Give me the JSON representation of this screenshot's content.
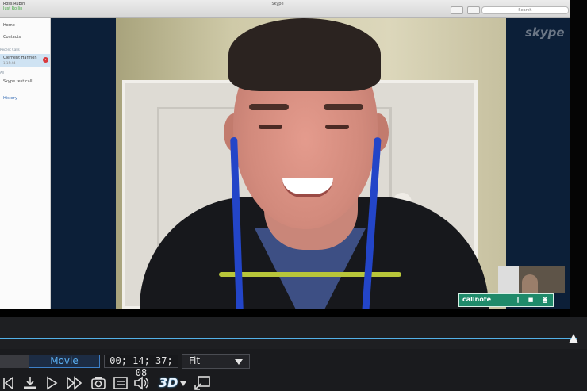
{
  "skype": {
    "user_name": "Ross Rubin",
    "user_status": "Just Rollin",
    "window_title": "Skype",
    "search_placeholder": "Search",
    "sidebar": {
      "home": "Home",
      "contacts": "Contacts",
      "recent_header": "Recent Calls",
      "active_contact": "Clement Harmon",
      "active_sub": "1:15:44",
      "badge": "1",
      "group_header": "All",
      "skype_test": "Skype test call",
      "history": "History"
    },
    "logo_text": "skype",
    "callnote_label": "callnote"
  },
  "player": {
    "mode_label": "Movie",
    "timecode": "00; 14; 37; 08",
    "zoom_label": "Fit",
    "threed_label": "3D",
    "timeline_progress": 0.985
  },
  "icons": [
    "prev-frame-icon",
    "mark-icon",
    "play-icon",
    "fast-forward-icon",
    "snapshot-icon",
    "subtitle-icon",
    "volume-icon",
    "3d-icon",
    "external-display-icon"
  ],
  "colors": {
    "accent_blue": "#53b1e8",
    "callnote_green": "#1f8a6a",
    "skype_blue": "#0c1f38"
  }
}
